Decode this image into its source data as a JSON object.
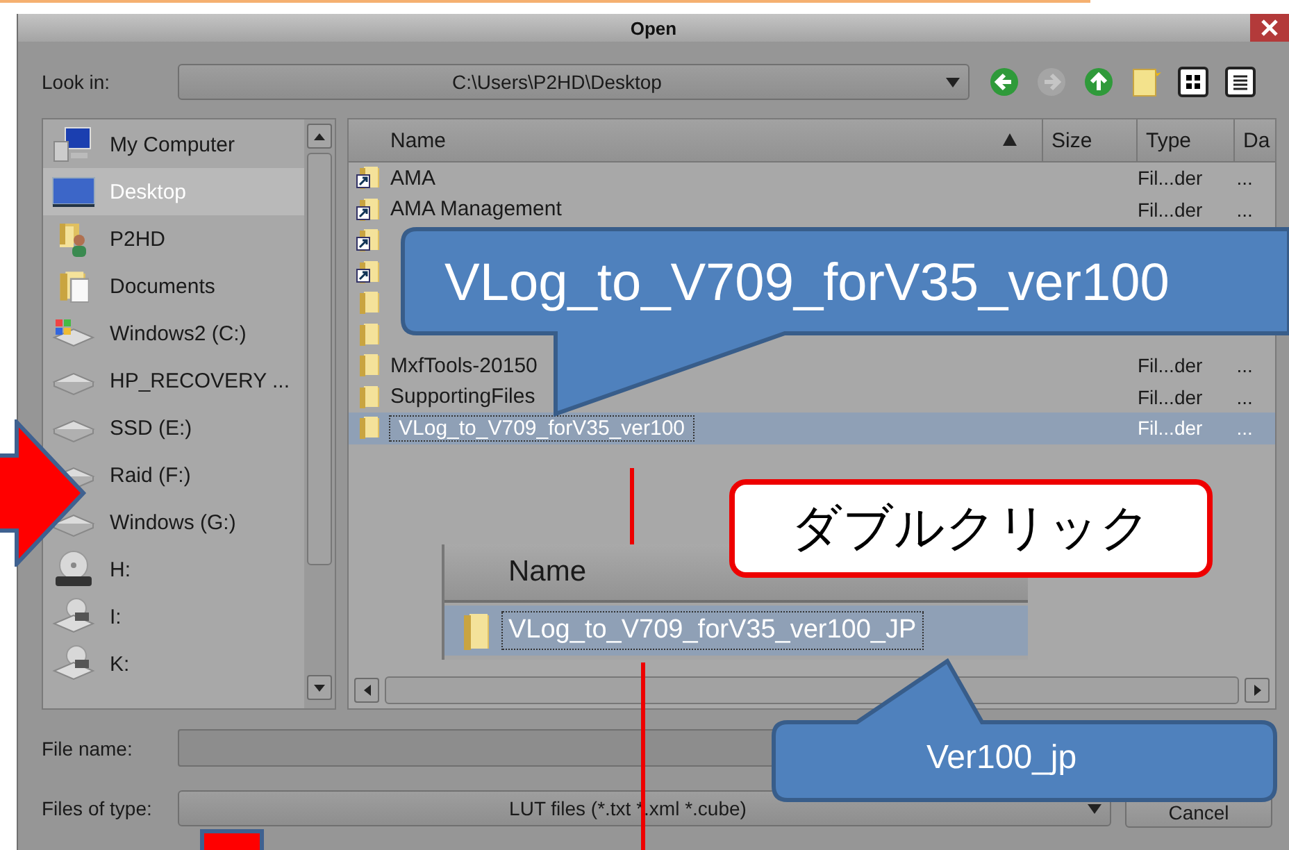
{
  "window": {
    "title": "Open"
  },
  "look_in": {
    "label": "Look in:",
    "value": "C:\\Users\\P2HD\\Desktop"
  },
  "toolbar": [
    {
      "kind": "back",
      "disabled": false
    },
    {
      "kind": "forward",
      "disabled": true
    },
    {
      "kind": "up",
      "disabled": false
    },
    {
      "kind": "new-folder",
      "disabled": false
    },
    {
      "kind": "thumbnails",
      "disabled": false
    },
    {
      "kind": "details",
      "disabled": false
    }
  ],
  "sidebar": {
    "items": [
      {
        "kind": "computer",
        "label": "My Computer",
        "selected": false
      },
      {
        "kind": "desktop",
        "label": "Desktop",
        "selected": true
      },
      {
        "kind": "user-folder",
        "label": "P2HD",
        "selected": false
      },
      {
        "kind": "documents",
        "label": "Documents",
        "selected": false
      },
      {
        "kind": "system-drive",
        "label": "Windows2 (C:)",
        "selected": false
      },
      {
        "kind": "drive",
        "label": "HP_RECOVERY ...",
        "selected": false
      },
      {
        "kind": "drive",
        "label": "SSD (E:)",
        "selected": false
      },
      {
        "kind": "drive",
        "label": "Raid (F:)",
        "selected": false
      },
      {
        "kind": "drive",
        "label": "Windows  (G:)",
        "selected": false
      },
      {
        "kind": "dvd",
        "label": "H:",
        "selected": false
      },
      {
        "kind": "disc",
        "label": "I:",
        "selected": false
      },
      {
        "kind": "disc",
        "label": "K:",
        "selected": false
      }
    ]
  },
  "file_list": {
    "columns": [
      {
        "label": "Name",
        "sorted": true
      },
      {
        "label": "Size",
        "sorted": false
      },
      {
        "label": "Type",
        "sorted": false
      },
      {
        "label": "Da",
        "sorted": false
      }
    ],
    "rows": [
      {
        "kind": "shortcut",
        "name": "AMA",
        "type": "Fil...der",
        "date": "...",
        "selected": false
      },
      {
        "kind": "shortcut",
        "name": "AMA Management",
        "type": "Fil...der",
        "date": "...",
        "selected": false
      },
      {
        "kind": "shortcut",
        "selected": false
      },
      {
        "kind": "shortcut",
        "selected": false
      },
      {
        "kind": "folder",
        "selected": false
      },
      {
        "kind": "folder",
        "selected": false
      },
      {
        "kind": "folder",
        "name": "MxfTools-20150",
        "type": "Fil...der",
        "date": "...",
        "selected": false
      },
      {
        "kind": "folder",
        "name": "SupportingFiles",
        "type": "Fil...der",
        "date": "...",
        "selected": false
      },
      {
        "kind": "folder",
        "name": "VLog_to_V709_forV35_ver100",
        "type": "Fil...der",
        "date": "...",
        "selected": true
      }
    ]
  },
  "file_name": {
    "label": "File name:"
  },
  "file_type": {
    "label": "Files of type:",
    "value": "LUT files (*.txt *.xml *.cube)"
  },
  "buttons": [
    {
      "label": "Cancel"
    }
  ],
  "annotations": {
    "callouts": [
      {
        "kind": "blue",
        "text": "VLog_to_V709_forV35_ver100"
      },
      {
        "kind": "outlined",
        "text": "ダブルクリック"
      },
      {
        "kind": "blue",
        "text": "Ver100_jp"
      }
    ],
    "inset": {
      "header": "Name",
      "item": "VLog_to_V709_forV35_ver100_JP"
    }
  }
}
